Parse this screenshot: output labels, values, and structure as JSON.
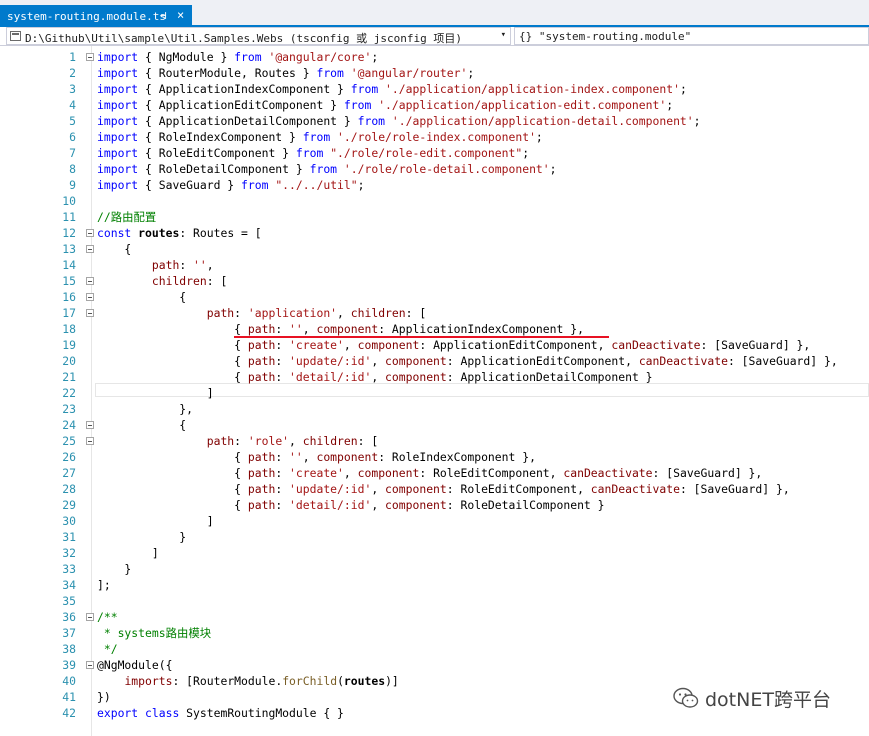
{
  "tab": {
    "title": "system-routing.module.ts",
    "pin_glyph": "⊣",
    "close_glyph": "×"
  },
  "navbar": {
    "project_path": "D:\\Github\\Util\\sample\\Util.Samples.Webs (tsconfig 或 jsconfig 项目)",
    "scope": "{} \"system-routing.module\"",
    "dropdown_glyph": "▾"
  },
  "code_lines": [
    {
      "n": "1",
      "fold": true,
      "html": "<span class='kw'>import</span> { NgModule } <span class='kw'>from</span> <span class='str'>'@angular/core'</span>;"
    },
    {
      "n": "2",
      "fold": false,
      "html": "<span class='kw'>import</span> { RouterModule, Routes } <span class='kw'>from</span> <span class='str'>'@angular/router'</span>;"
    },
    {
      "n": "3",
      "fold": false,
      "html": "<span class='kw'>import</span> { ApplicationIndexComponent } <span class='kw'>from</span> <span class='str'>'./application/application-index.component'</span>;"
    },
    {
      "n": "4",
      "fold": false,
      "html": "<span class='kw'>import</span> { ApplicationEditComponent } <span class='kw'>from</span> <span class='str'>'./application/application-edit.component'</span>;"
    },
    {
      "n": "5",
      "fold": false,
      "html": "<span class='kw'>import</span> { ApplicationDetailComponent } <span class='kw'>from</span> <span class='str'>'./application/application-detail.component'</span>;"
    },
    {
      "n": "6",
      "fold": false,
      "html": "<span class='kw'>import</span> { RoleIndexComponent } <span class='kw'>from</span> <span class='str'>'./role/role-index.component'</span>;"
    },
    {
      "n": "7",
      "fold": false,
      "html": "<span class='kw'>import</span> { RoleEditComponent } <span class='kw'>from</span> <span class='str'>\"./role/role-edit.component\"</span>;"
    },
    {
      "n": "8",
      "fold": false,
      "html": "<span class='kw'>import</span> { RoleDetailComponent } <span class='kw'>from</span> <span class='str'>'./role/role-detail.component'</span>;"
    },
    {
      "n": "9",
      "fold": false,
      "html": "<span class='kw'>import</span> { SaveGuard } <span class='kw'>from</span> <span class='str'>\"../../util\"</span>;"
    },
    {
      "n": "10",
      "fold": false,
      "html": ""
    },
    {
      "n": "11",
      "fold": false,
      "html": "<span class='com'>//路由配置</span>"
    },
    {
      "n": "12",
      "fold": true,
      "html": "<span class='kw'>const</span> <span class='bold'>routes</span>: Routes = ["
    },
    {
      "n": "13",
      "fold": true,
      "html": "    {"
    },
    {
      "n": "14",
      "fold": false,
      "html": "        <span class='prop'>path</span>: <span class='str'>''</span>,"
    },
    {
      "n": "15",
      "fold": true,
      "html": "        <span class='prop'>children</span>: ["
    },
    {
      "n": "16",
      "fold": true,
      "html": "            {"
    },
    {
      "n": "17",
      "fold": true,
      "html": "                <span class='prop'>path</span>: <span class='str'>'application'</span>, <span class='prop'>children</span>: ["
    },
    {
      "n": "18",
      "fold": false,
      "html": "                    { <span class='prop'>path</span>: <span class='str'>''</span>, <span class='prop'>component</span>: ApplicationIndexComponent },"
    },
    {
      "n": "19",
      "fold": false,
      "html": "                    { <span class='prop'>path</span>: <span class='str'>'create'</span>, <span class='prop'>component</span>: ApplicationEditComponent, <span class='prop'>canDeactivate</span>: [SaveGuard] },"
    },
    {
      "n": "20",
      "fold": false,
      "html": "                    { <span class='prop'>path</span>: <span class='str'>'update/:id'</span>, <span class='prop'>component</span>: ApplicationEditComponent, <span class='prop'>canDeactivate</span>: [SaveGuard] },"
    },
    {
      "n": "21",
      "fold": false,
      "html": "                    { <span class='prop'>path</span>: <span class='str'>'detail/:id'</span>, <span class='prop'>component</span>: ApplicationDetailComponent }"
    },
    {
      "n": "22",
      "fold": false,
      "html": "                ]"
    },
    {
      "n": "23",
      "fold": false,
      "html": "            },"
    },
    {
      "n": "24",
      "fold": true,
      "html": "            {"
    },
    {
      "n": "25",
      "fold": true,
      "html": "                <span class='prop'>path</span>: <span class='str'>'role'</span>, <span class='prop'>children</span>: ["
    },
    {
      "n": "26",
      "fold": false,
      "html": "                    { <span class='prop'>path</span>: <span class='str'>''</span>, <span class='prop'>component</span>: RoleIndexComponent },"
    },
    {
      "n": "27",
      "fold": false,
      "html": "                    { <span class='prop'>path</span>: <span class='str'>'create'</span>, <span class='prop'>component</span>: RoleEditComponent, <span class='prop'>canDeactivate</span>: [SaveGuard] },"
    },
    {
      "n": "28",
      "fold": false,
      "html": "                    { <span class='prop'>path</span>: <span class='str'>'update/:id'</span>, <span class='prop'>component</span>: RoleEditComponent, <span class='prop'>canDeactivate</span>: [SaveGuard] },"
    },
    {
      "n": "29",
      "fold": false,
      "html": "                    { <span class='prop'>path</span>: <span class='str'>'detail/:id'</span>, <span class='prop'>component</span>: RoleDetailComponent }"
    },
    {
      "n": "30",
      "fold": false,
      "html": "                ]"
    },
    {
      "n": "31",
      "fold": false,
      "html": "            }"
    },
    {
      "n": "32",
      "fold": false,
      "html": "        ]"
    },
    {
      "n": "33",
      "fold": false,
      "html": "    }"
    },
    {
      "n": "34",
      "fold": false,
      "html": "];"
    },
    {
      "n": "35",
      "fold": false,
      "html": ""
    },
    {
      "n": "36",
      "fold": true,
      "html": "<span class='com'>/**</span>"
    },
    {
      "n": "37",
      "fold": false,
      "html": "<span class='com'> * systems路由模块</span>"
    },
    {
      "n": "38",
      "fold": false,
      "html": "<span class='com'> */</span>"
    },
    {
      "n": "39",
      "fold": true,
      "html": "@NgModule({"
    },
    {
      "n": "40",
      "fold": false,
      "html": "    <span class='prop'>imports</span>: [RouterModule.<span class='fn'>forChild</span>(<span class='bold'>routes</span>)]"
    },
    {
      "n": "41",
      "fold": false,
      "html": "})"
    },
    {
      "n": "42",
      "fold": false,
      "html": "<span class='kw'>export</span> <span class='kw'>class</span> SystemRoutingModule { }"
    }
  ],
  "watermark": {
    "text": "dotNET跨平台"
  },
  "colors": {
    "accent": "#007acc",
    "keyword": "#0000ff",
    "string": "#a31515",
    "comment": "#008000",
    "property": "#800000",
    "line_number": "#2b91af",
    "highlight_underline": "#e81123"
  }
}
